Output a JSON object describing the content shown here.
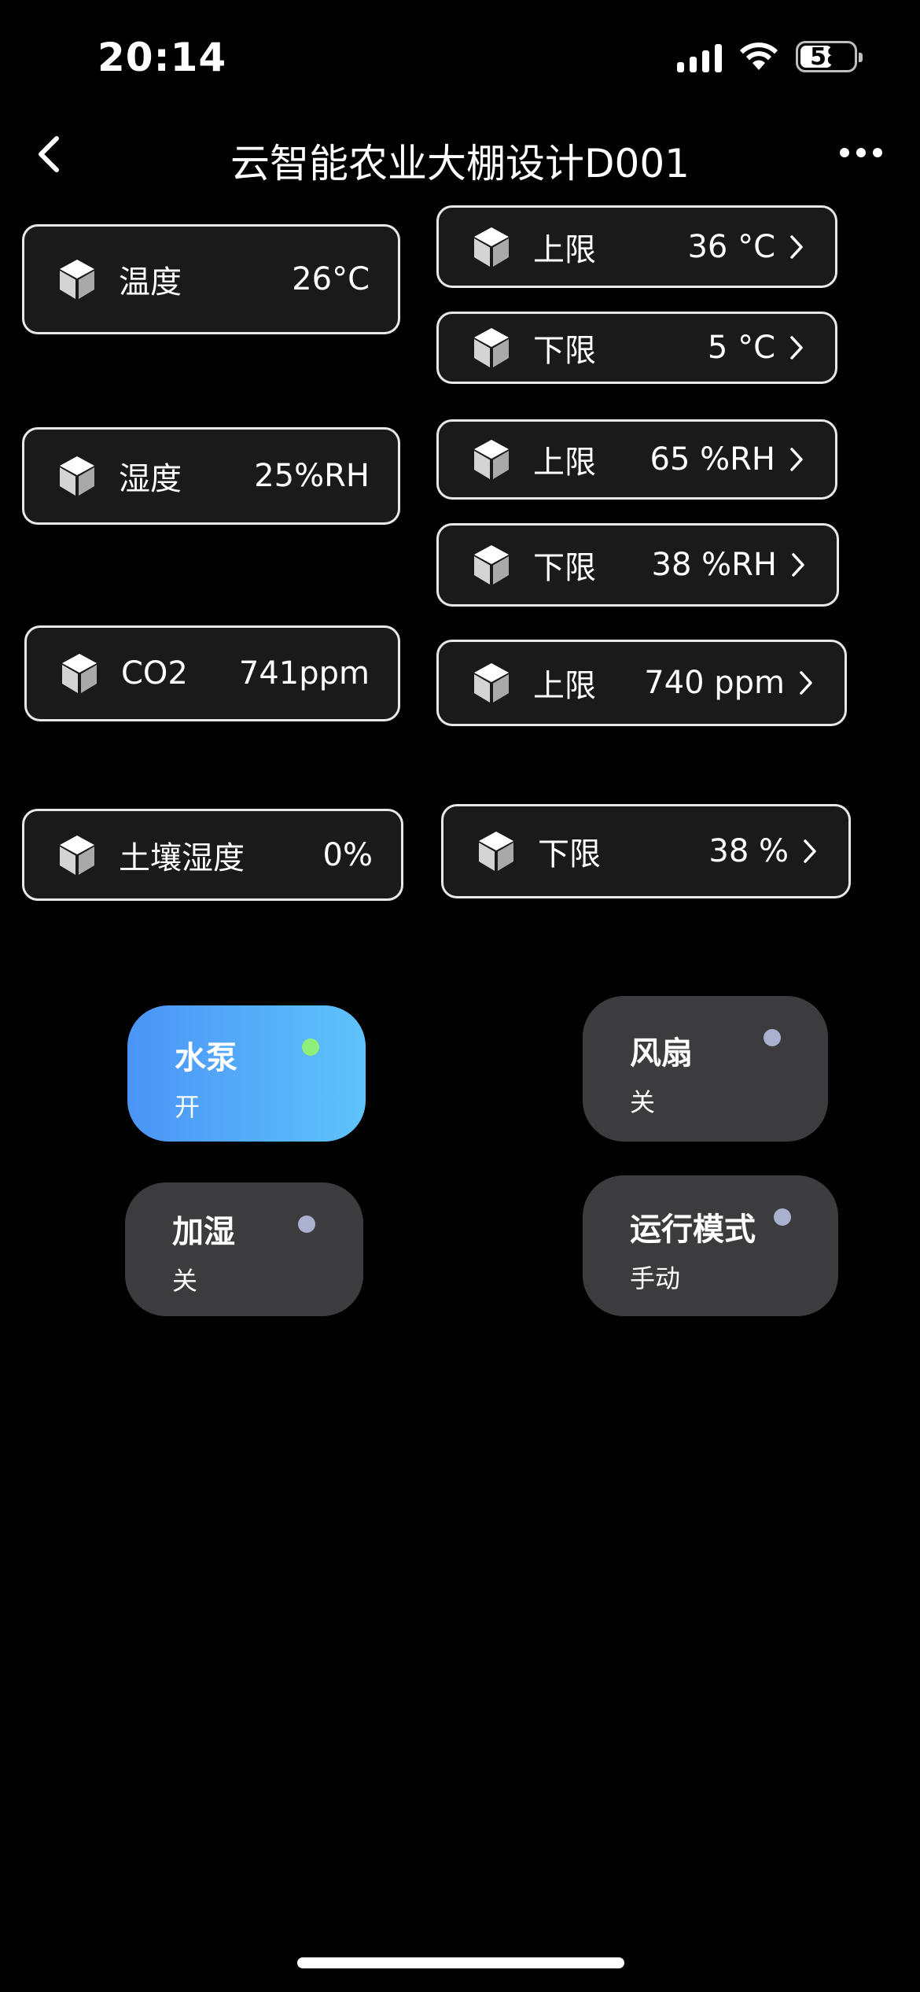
{
  "status_bar": {
    "time": "20:14",
    "battery": "58"
  },
  "nav": {
    "title": "云智能农业大棚设计D001"
  },
  "sensors": [
    {
      "label": "温度",
      "value": "26°C"
    },
    {
      "label": "湿度",
      "value": "25%RH"
    },
    {
      "label": "CO2",
      "value": "741ppm"
    },
    {
      "label": "土壤湿度",
      "value": "0%"
    }
  ],
  "limits": [
    {
      "label": "上限",
      "value": "36 °C"
    },
    {
      "label": "下限",
      "value": "5 °C"
    },
    {
      "label": "上限",
      "value": "65 %RH"
    },
    {
      "label": "下限",
      "value": "38 %RH"
    },
    {
      "label": "上限",
      "value": "740 ppm"
    },
    {
      "label": "下限",
      "value": "38 %"
    }
  ],
  "controls": [
    {
      "title": "水泵",
      "status": "开",
      "active": true
    },
    {
      "title": "风扇",
      "status": "关",
      "active": false
    },
    {
      "title": "加湿",
      "status": "关",
      "active": false
    },
    {
      "title": "运行模式",
      "status": "手动",
      "active": false
    }
  ],
  "colors": {
    "background": "#000000",
    "card_background": "#1a1a1a",
    "card_border": "#e8e8e8",
    "tile_off": "#3c3c3e",
    "tile_on_start": "#4a94f6",
    "tile_on_end": "#5fc3fb",
    "dot_on": "#8ef07a",
    "dot_off": "#a9b1cf"
  }
}
